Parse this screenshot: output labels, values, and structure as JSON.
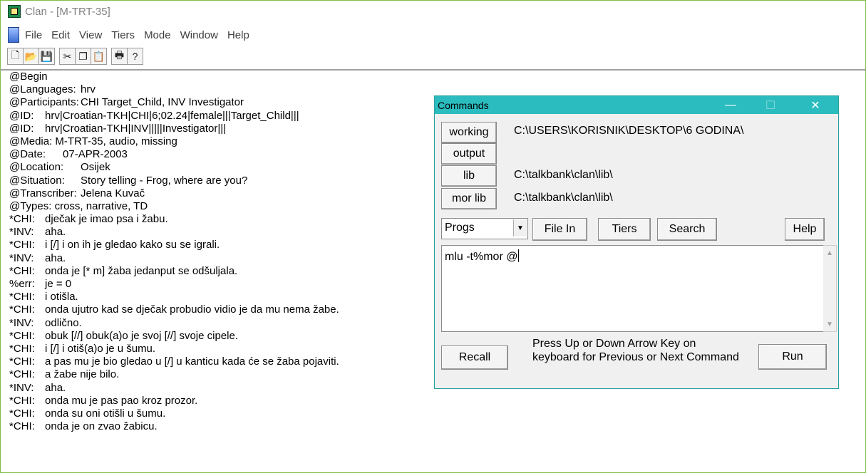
{
  "window": {
    "title": "Clan - [M-TRT-35]"
  },
  "menu": [
    "File",
    "Edit",
    "View",
    "Tiers",
    "Mode",
    "Window",
    "Help"
  ],
  "toolbar_groups": [
    [
      {
        "icon": "new-file-icon",
        "glyph": "🗋"
      },
      {
        "icon": "open-folder-icon",
        "glyph": "📂"
      },
      {
        "icon": "save-icon",
        "glyph": "💾"
      }
    ],
    [
      {
        "icon": "cut-icon",
        "glyph": "✂"
      },
      {
        "icon": "copy-icon",
        "glyph": "❐"
      },
      {
        "icon": "paste-icon",
        "glyph": "📋"
      }
    ],
    [
      {
        "icon": "print-icon",
        "glyph": "🖶"
      },
      {
        "icon": "help-icon",
        "glyph": "?"
      }
    ]
  ],
  "transcript": [
    "@Begin",
    "@Languages:\thrv",
    "@Participants:\tCHI Target_Child, INV Investigator",
    "@ID:\thrv|Croatian-TKH|CHI|6;02.24|female|||Target_Child|||",
    "@ID:\thrv|Croatian-TKH|INV|||||Investigator|||",
    "@Media: M-TRT-35, audio, missing",
    "@Date:\t07-APR-2003",
    "@Location:\tOsijek",
    "@Situation:\tStory telling - Frog, where are you?",
    "@Transcriber:\tJelena Kuvač",
    "@Types: cross, narrative, TD",
    "*CHI:\tdječak je imao psa i žabu.",
    "*INV:\taha.",
    "*CHI:\ti [/] i on ih je gledao kako su se igrali.",
    "*INV:\taha.",
    "*CHI:\tonda je [* m] žaba jedanput se odšuljala.",
    "%err:\tje = 0",
    "*CHI:\ti otišla.",
    "*CHI:\tonda ujutro kad se dječak probudio vidio je da mu nema žabe.",
    "*INV:\todlično.",
    "*CHI:\tobuk [//] obuk(a)o je svoj [//] svoje cipele.",
    "*CHI:\ti [/] i otiš(a)o je u šumu.",
    "*CHI:\ta pas mu je bio gledao u [/] u kanticu kada će se žaba pojaviti.",
    "*CHI:\ta žabe nije bilo.",
    "*INV:\taha.",
    "*CHI:\tonda mu je pas pao kroz prozor.",
    "*CHI:\tonda su oni otišli u šumu.",
    "*CHI:\tonda je on zvao žabicu."
  ],
  "dialog": {
    "title": "Commands",
    "controls": {
      "minimize": "—",
      "maximize": "☐",
      "close": "✕"
    },
    "dirs": [
      {
        "label": "working",
        "path": "C:\\USERS\\KORISNIK\\DESKTOP\\6 GODINA\\"
      },
      {
        "label": "output",
        "path": ""
      },
      {
        "label": "lib",
        "path": "C:\\talkbank\\clan\\lib\\"
      },
      {
        "label": "mor lib",
        "path": "C:\\talkbank\\clan\\lib\\"
      }
    ],
    "progs_value": "Progs",
    "file_in_label": "File In",
    "tiers_label": "Tiers",
    "search_label": "Search",
    "help_label": "Help",
    "command_text": "mlu -t%mor @",
    "recall_label": "Recall",
    "hint": "Press Up or Down Arrow Key on keyboard for Previous or Next Command",
    "run_label": "Run"
  }
}
